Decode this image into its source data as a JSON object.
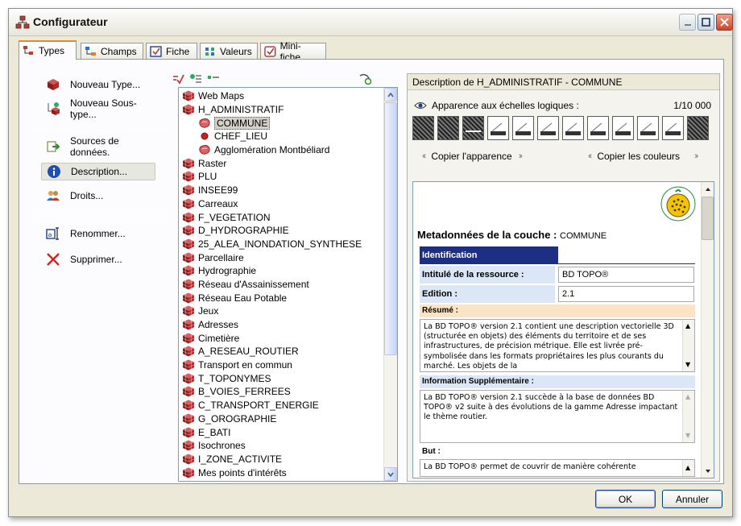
{
  "window": {
    "title": "Configurateur"
  },
  "tabs": [
    {
      "label": "Types",
      "icon": "types-icon",
      "active": true
    },
    {
      "label": "Champs",
      "icon": "fields-icon",
      "active": false
    },
    {
      "label": "Fiche",
      "icon": "form-icon",
      "active": false
    },
    {
      "label": "Valeurs",
      "icon": "values-icon",
      "active": false
    },
    {
      "label": "Mini-fiche",
      "icon": "mini-form-icon",
      "active": false
    }
  ],
  "actions": {
    "new_type": "Nouveau Type...",
    "new_subtype": "Nouveau Sous-type...",
    "data_sources": "Sources de données.",
    "description": "Description...",
    "rights": "Droits...",
    "rename": "Renommer...",
    "delete": "Supprimer..."
  },
  "tree": {
    "items": [
      {
        "label": "Web Maps",
        "level": 0,
        "icon": "cube-icon"
      },
      {
        "label": "H_ADMINISTRATIF",
        "level": 0,
        "icon": "cube-icon"
      },
      {
        "label": "COMMUNE",
        "level": 1,
        "icon": "polygon-icon",
        "selected": true
      },
      {
        "label": "CHEF_LIEU",
        "level": 1,
        "icon": "point-icon"
      },
      {
        "label": "Agglomération Montbéliard",
        "level": 1,
        "icon": "polygon-icon"
      },
      {
        "label": "Raster",
        "level": 0,
        "icon": "cube-icon"
      },
      {
        "label": "PLU",
        "level": 0,
        "icon": "cube-icon"
      },
      {
        "label": "INSEE99",
        "level": 0,
        "icon": "cube-icon"
      },
      {
        "label": "Carreaux",
        "level": 0,
        "icon": "cube-icon"
      },
      {
        "label": "F_VEGETATION",
        "level": 0,
        "icon": "cube-icon"
      },
      {
        "label": "D_HYDROGRAPHIE",
        "level": 0,
        "icon": "cube-icon"
      },
      {
        "label": "25_ALEA_INONDATION_SYNTHESE",
        "level": 0,
        "icon": "cube-icon"
      },
      {
        "label": "Parcellaire",
        "level": 0,
        "icon": "cube-icon"
      },
      {
        "label": "Hydrographie",
        "level": 0,
        "icon": "cube-icon"
      },
      {
        "label": "Réseau d'Assainissement",
        "level": 0,
        "icon": "cube-icon"
      },
      {
        "label": "Réseau Eau Potable",
        "level": 0,
        "icon": "cube-icon"
      },
      {
        "label": "Jeux",
        "level": 0,
        "icon": "cube-icon"
      },
      {
        "label": "Adresses",
        "level": 0,
        "icon": "cube-icon"
      },
      {
        "label": "Cimetière",
        "level": 0,
        "icon": "cube-icon"
      },
      {
        "label": "A_RESEAU_ROUTIER",
        "level": 0,
        "icon": "cube-icon"
      },
      {
        "label": "Transport en commun",
        "level": 0,
        "icon": "cube-icon"
      },
      {
        "label": "T_TOPONYMES",
        "level": 0,
        "icon": "cube-icon"
      },
      {
        "label": "B_VOIES_FERREES",
        "level": 0,
        "icon": "cube-icon"
      },
      {
        "label": "C_TRANSPORT_ENERGIE",
        "level": 0,
        "icon": "cube-icon"
      },
      {
        "label": "G_OROGRAPHIE",
        "level": 0,
        "icon": "cube-icon"
      },
      {
        "label": "E_BATI",
        "level": 0,
        "icon": "cube-icon"
      },
      {
        "label": "Isochrones",
        "level": 0,
        "icon": "cube-icon"
      },
      {
        "label": "I_ZONE_ACTIVITE",
        "level": 0,
        "icon": "cube-icon"
      },
      {
        "label": "Mes points d'intérêts",
        "level": 0,
        "icon": "cube-icon"
      }
    ]
  },
  "description_panel": {
    "header": "Description de H_ADMINISTRATIF - COMMUNE",
    "scale_label": "Apparence aux échelles logiques :",
    "scale_value": "1/10 000",
    "copy_appearance": "Copier l'apparence",
    "copy_colors": "Copier les couleurs"
  },
  "metadata": {
    "title": "Metadonnées de la couche :",
    "layer": "COMMUNE",
    "identification": "Identification",
    "resource_label": "Intitulé de la ressource :",
    "resource_value": "BD TOPO®",
    "edition_label": "Edition :",
    "edition_value": "2.1",
    "summary_label": "Résumé :",
    "summary_text": "La BD TOPO® version 2.1 contient une description vectorielle 3D (structurée en objets) des éléments du territoire et de ses infrastructures, de précision métrique. Elle est livrée pré-symbolisée dans les formats propriétaires les plus courants du marché. Les objets de la",
    "extra_label": "Information Supplémentaire :",
    "extra_text": "La BD TOPO® version 2.1 succède à la base de données BD TOPO® v2 suite à des évolutions de la gamme Adresse impactant le thème routier.",
    "purpose_label": "But :",
    "purpose_text": "La BD TOPO® permet de couvrir de manière cohérente"
  },
  "buttons": {
    "ok": "OK",
    "cancel": "Annuler"
  },
  "colors": {
    "accent_tab": "#e68b2c",
    "ident_bar": "#1d2f82",
    "label_blue": "#dbe6f7",
    "label_orange": "#fbe4c6",
    "cube_red": "#a11d1d"
  }
}
